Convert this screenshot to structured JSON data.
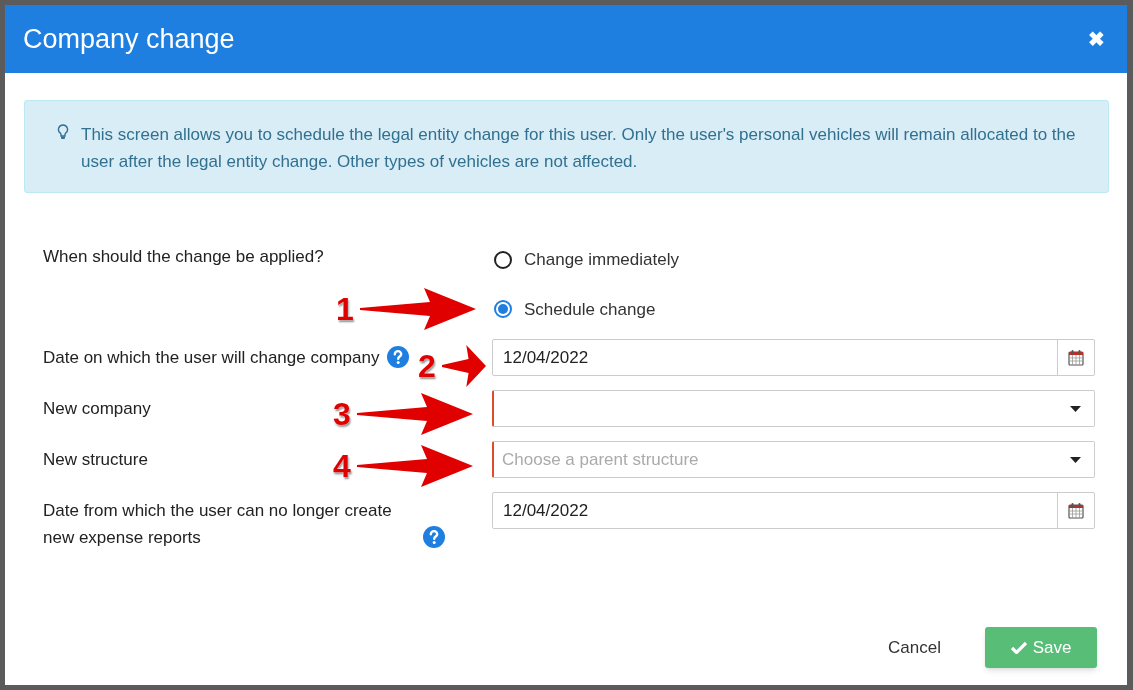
{
  "dialog": {
    "title": "Company change",
    "close": "✖"
  },
  "info": {
    "text": "This screen allows you to schedule the legal entity change for this user. Only the user's personal vehicles will remain allocated to the user after the legal entity change. Other types of vehicles are not affected."
  },
  "timing": {
    "label": "When should the change be applied?",
    "options": [
      {
        "label": "Change immediately",
        "selected": false
      },
      {
        "label": "Schedule change",
        "selected": true
      }
    ]
  },
  "fields": [
    {
      "kind": "date",
      "label": "Date on which the user will change company",
      "help": true,
      "required": false,
      "value": "12/04/2022"
    },
    {
      "kind": "select",
      "label": "New company",
      "help": false,
      "required": true
    },
    {
      "kind": "select",
      "label": "New structure",
      "help": false,
      "required": true,
      "placeholder": "Choose a parent structure"
    },
    {
      "kind": "date",
      "label": "Date from which the user can no longer create new expense reports",
      "help": true,
      "required": false,
      "value": "12/04/2022"
    }
  ],
  "buttons": [
    {
      "kind": "link",
      "label": "Cancel"
    },
    {
      "kind": "primary",
      "label": "Save"
    }
  ],
  "annotations": [
    {
      "number": "1"
    },
    {
      "number": "2"
    },
    {
      "number": "3"
    },
    {
      "number": "4"
    }
  ]
}
